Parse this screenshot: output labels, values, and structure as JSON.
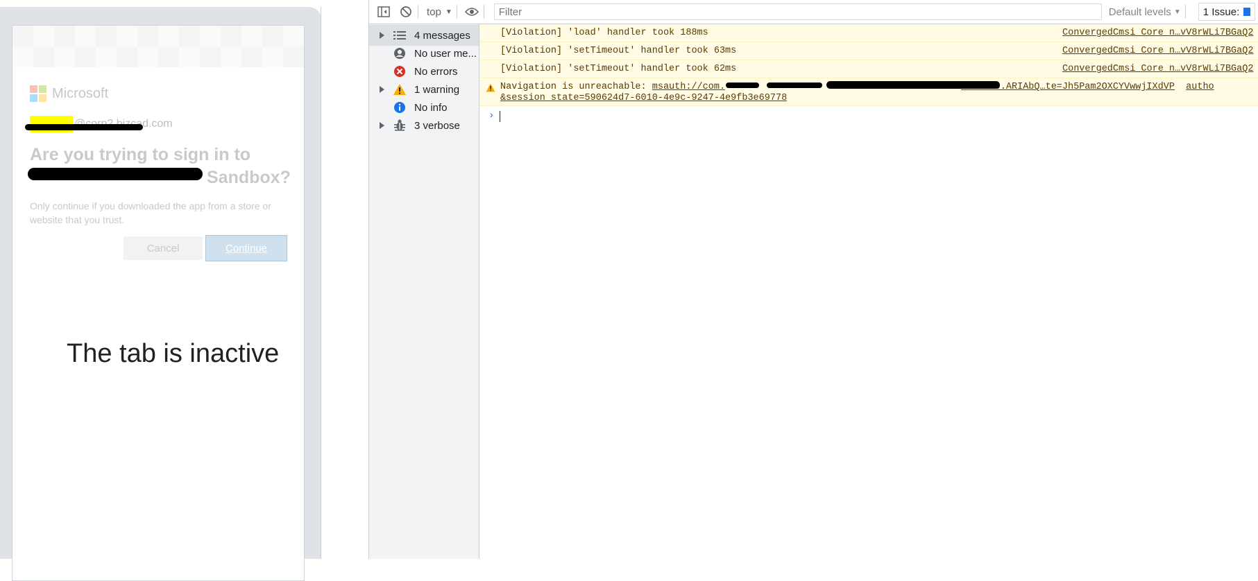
{
  "device": {
    "ms_name": "Microsoft",
    "account": "@corp2.bizcad.com",
    "ask_line1": "Are you trying to sign in to",
    "ask_line2_suffix": "Sandbox?",
    "hint": "Only continue if you downloaded the app from a store or website that you trust.",
    "cancel_label": "Cancel",
    "continue_label": "Continue",
    "inactive_text": "The tab is inactive"
  },
  "toolbar": {
    "context": "top",
    "filter_placeholder": "Filter",
    "levels": "Default levels",
    "issues": "1 Issue:"
  },
  "sidebar": {
    "items": [
      {
        "label": "4 messages",
        "icon": "list-icon"
      },
      {
        "label": "No user me...",
        "icon": "user-icon"
      },
      {
        "label": "No errors",
        "icon": "error-icon"
      },
      {
        "label": "1 warning",
        "icon": "warning-icon"
      },
      {
        "label": "No info",
        "icon": "info-icon"
      },
      {
        "label": "3 verbose",
        "icon": "bug-icon"
      }
    ]
  },
  "console": {
    "rows": [
      {
        "msg": "[Violation] 'load' handler took 188ms",
        "src": "ConvergedCmsi_Core_n…vV8rWLi7BGaQ2"
      },
      {
        "msg": "[Violation] 'setTimeout' handler took 63ms",
        "src": "ConvergedCmsi_Core_n…vV8rWLi7BGaQ2"
      },
      {
        "msg": "[Violation] 'setTimeout' handler took 62ms",
        "src": "ConvergedCmsi_Core_n…vV8rWLi7BGaQ2"
      }
    ],
    "warning_prefix": "Navigation is unreachable: ",
    "warning_link_start": "msauth://com.",
    "warning_link_end": "?code=0.ARIAbQ…te=Jh5Pam2OXCYVwwjIXdVP",
    "warning_tail": "autho",
    "warning_line2": "&session_state=590624d7-6010-4e9c-9247-4e9fb3e69778"
  },
  "colors": {
    "violation_bg": "#fffbe5",
    "accent": "#1a73e8",
    "error": "#d93025",
    "warning": "#f9ab00"
  }
}
